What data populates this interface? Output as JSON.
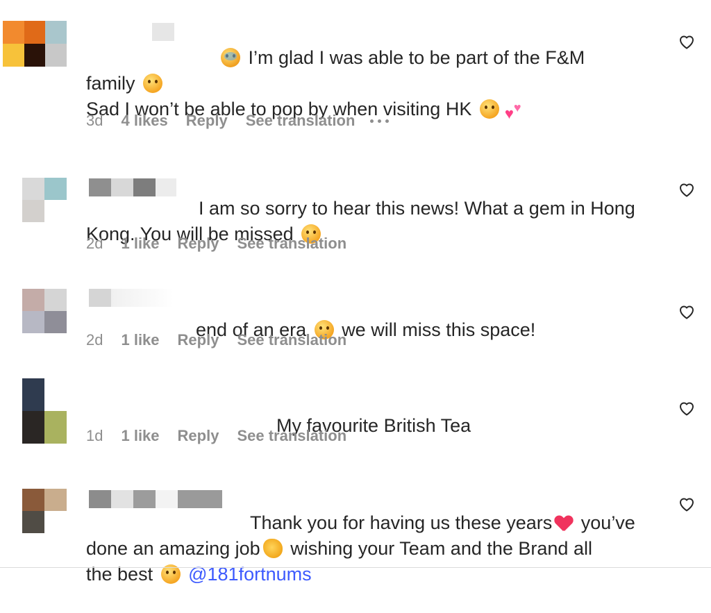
{
  "comments": [
    {
      "text_lines": [
        "I’m glad I was able to be part of the F&M",
        "family",
        "Sad I won’t be able to pop by when visiting HK"
      ],
      "age": "3d",
      "likes": "4 likes",
      "reply": "Reply",
      "translate": "See translation",
      "avatar_colors": [
        "#f28a2e",
        "#e06a18",
        "#a9c6cc",
        "#f7c23a",
        "#2a1208",
        "#c8c8c8"
      ],
      "has_more": true
    },
    {
      "text_lines": [
        "I am so sorry to hear this news! What a gem in Hong",
        "Kong. You will be missed"
      ],
      "age": "2d",
      "likes": "1 like",
      "reply": "Reply",
      "translate": "See translation",
      "avatar_colors": [
        "#d9d9d9",
        "#9bc6cb",
        "#d3d0cd",
        "#ffffff"
      ]
    },
    {
      "text_lines": [
        "end of an era",
        "we will miss this space!"
      ],
      "age": "2d",
      "likes": "1 like",
      "reply": "Reply",
      "translate": "See translation",
      "avatar_colors": [
        "#c4aca8",
        "#d5d5d5",
        "#b7b8c4",
        "#8f8e98"
      ]
    },
    {
      "text_lines": [
        "My favourite British Tea"
      ],
      "age": "1d",
      "likes": "1 like",
      "reply": "Reply",
      "translate": "See translation",
      "avatar_colors": [
        "#2f3b4f",
        "#ffffff",
        "#2a2624",
        "#a9b25f"
      ]
    },
    {
      "text_lines": [
        "Thank you for having us these years",
        "you’ve",
        "done an amazing job",
        "wishing your Team and the Brand all",
        "the best"
      ],
      "mention": "@181fortnums",
      "avatar_colors": [
        "#8a5a3a",
        "#c9ad8d",
        "#504c45",
        "#ffffff"
      ]
    }
  ],
  "icons": {
    "like": "heart-outline-icon",
    "more": "more-options-icon"
  },
  "colors": {
    "text": "#262626",
    "muted": "#8e8e8e",
    "mention": "#3d5afe"
  }
}
